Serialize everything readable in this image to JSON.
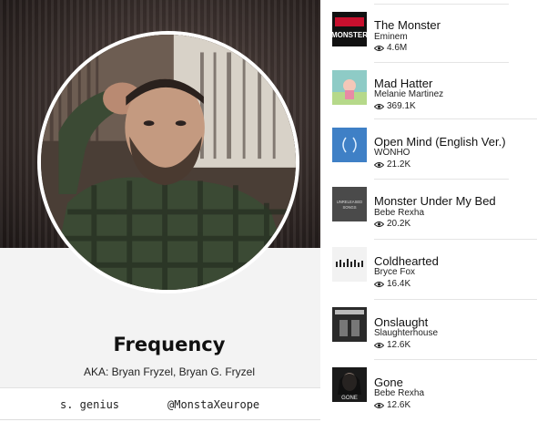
{
  "artist": {
    "name": "Frequency",
    "aka": "AKA: Bryan Fryzel, Bryan G. Fryzel",
    "social": {
      "genius": "s. genius",
      "instagram": "@MonstaXeurope"
    }
  },
  "songs": [
    {
      "title": "The Monster",
      "artist": "Eminem",
      "views": "4.6M",
      "cover_text": "MONSTER",
      "cover_color": "#111111"
    },
    {
      "title": "Mad Hatter",
      "artist": "Melanie Martinez",
      "views": "369.1K",
      "cover_color": "#8ecbc6"
    },
    {
      "title": "Open Mind (English Ver.)",
      "artist": "WONHO",
      "views": "21.2K",
      "cover_color": "#3f80c6"
    },
    {
      "title": "Monster Under My Bed",
      "artist": "Bebe Rexha",
      "views": "20.2K",
      "cover_text": "UNRELEASED SONGS",
      "cover_color": "#4a4a4a"
    },
    {
      "title": "Coldhearted",
      "artist": "Bryce Fox",
      "views": "16.4K",
      "cover_color": "#f2f2f2"
    },
    {
      "title": "Onslaught",
      "artist": "Slaughterhouse",
      "views": "12.6K",
      "cover_color": "#2a2a2a"
    },
    {
      "title": "Gone",
      "artist": "Bebe Rexha",
      "views": "12.6K",
      "cover_text": "GONE",
      "cover_color": "#1a1a1a"
    }
  ],
  "icons": {
    "views": "eye-icon"
  }
}
